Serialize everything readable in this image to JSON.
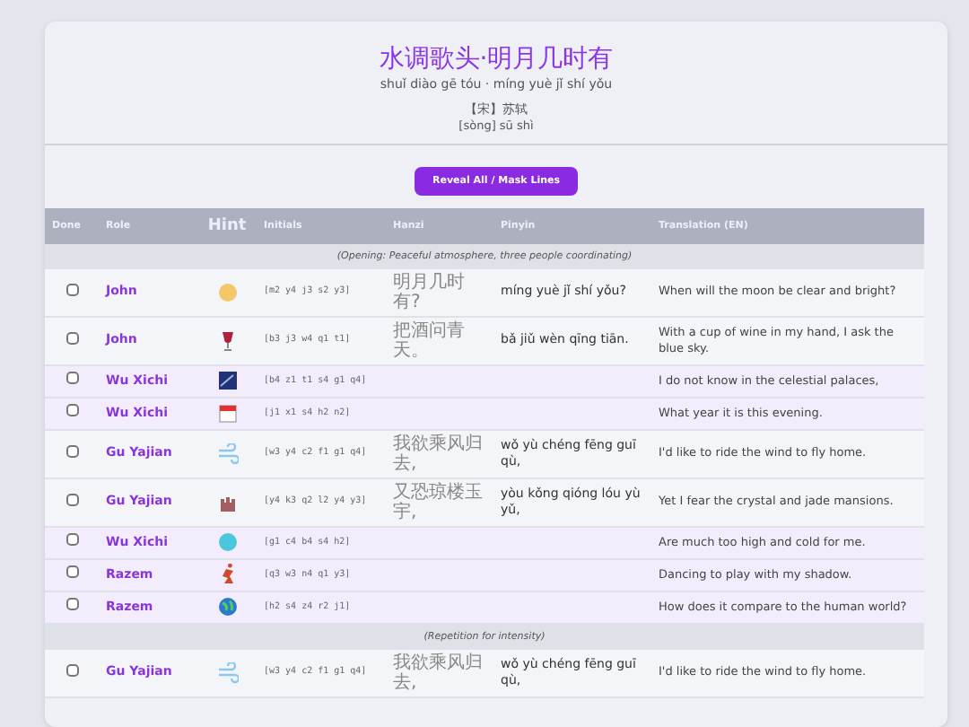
{
  "title": "水调歌头·明月几时有",
  "title_pinyin": "shuǐ diào gē tóu · míng yuè jǐ shí yǒu",
  "author": "【宋】苏轼",
  "author_pinyin": "[sòng] sū shì",
  "toggle_button": "Reveal All / Mask Lines",
  "columns": [
    "Done",
    "Role",
    "Hint",
    "Initials",
    "Hanzi",
    "Pinyin",
    "Translation (EN)"
  ],
  "rows": [
    {
      "kind": "section",
      "note": "(Opening: Peaceful atmosphere, three people coordinating)"
    },
    {
      "kind": "line",
      "checked": false,
      "masked": false,
      "role": "John",
      "initials": "[m2 y4 j3 s2 y3]",
      "hanzi": "明月几时有?",
      "pinyin": "míng yuè jǐ shí yǒu?",
      "translation": "When will the moon be clear and bright?"
    },
    {
      "kind": "line",
      "checked": false,
      "masked": false,
      "role": "John",
      "initials": "[b3 j3 w4 q1 t1]",
      "hanzi": "把酒问青天。",
      "pinyin": "bǎ jiǔ wèn qīng tiān.",
      "translation": "With a cup of wine in my hand, I ask the blue sky."
    },
    {
      "kind": "line",
      "checked": false,
      "masked": true,
      "role": "Wu Xichi",
      "initials": "[b4 z1 t1 s4 g1 q4]",
      "translation": "I do not know in the celestial palaces,"
    },
    {
      "kind": "line",
      "checked": false,
      "masked": true,
      "role": "Wu Xichi",
      "initials": "[j1 x1 s4 h2 n2]",
      "translation": "What year it is this evening."
    },
    {
      "kind": "line",
      "checked": false,
      "masked": false,
      "role": "Gu Yajian",
      "initials": "[w3 y4 c2 f1 g1 q4]",
      "hanzi": "我欲乘风归去,",
      "pinyin": "wǒ yù chéng fēng guī qù,",
      "translation": "I'd like to ride the wind to fly home."
    },
    {
      "kind": "line",
      "checked": false,
      "masked": false,
      "role": "Gu Yajian",
      "initials": "[y4 k3 q2 l2 y4 y3]",
      "hanzi": "又恐琼楼玉宇,",
      "pinyin": "yòu kǒng qióng lóu yù yǔ,",
      "translation": "Yet I fear the crystal and jade mansions."
    },
    {
      "kind": "line",
      "checked": false,
      "masked": true,
      "role": "Wu Xichi",
      "initials": "[g1 c4 b4 s4 h2]",
      "translation": "Are much too high and cold for me."
    },
    {
      "kind": "line",
      "checked": false,
      "masked": true,
      "role": "Razem",
      "initials": "[q3 w3 n4 q1 y3]",
      "translation": "Dancing to play with my shadow."
    },
    {
      "kind": "line",
      "checked": false,
      "masked": true,
      "role": "Razem",
      "initials": "[h2 s4 z4 r2 j1]",
      "translation": "How does it compare to the human world?"
    },
    {
      "kind": "section",
      "note": "(Repetition for intensity)"
    },
    {
      "kind": "line",
      "checked": false,
      "masked": false,
      "role": "Gu Yajian",
      "initials": "[w3 y4 c2 f1 g1 q4]",
      "hanzi": "我欲乘风归去,",
      "pinyin": "wǒ yù chéng fēng guī qù,",
      "translation": "I'd like to ride the wind to fly home."
    }
  ]
}
